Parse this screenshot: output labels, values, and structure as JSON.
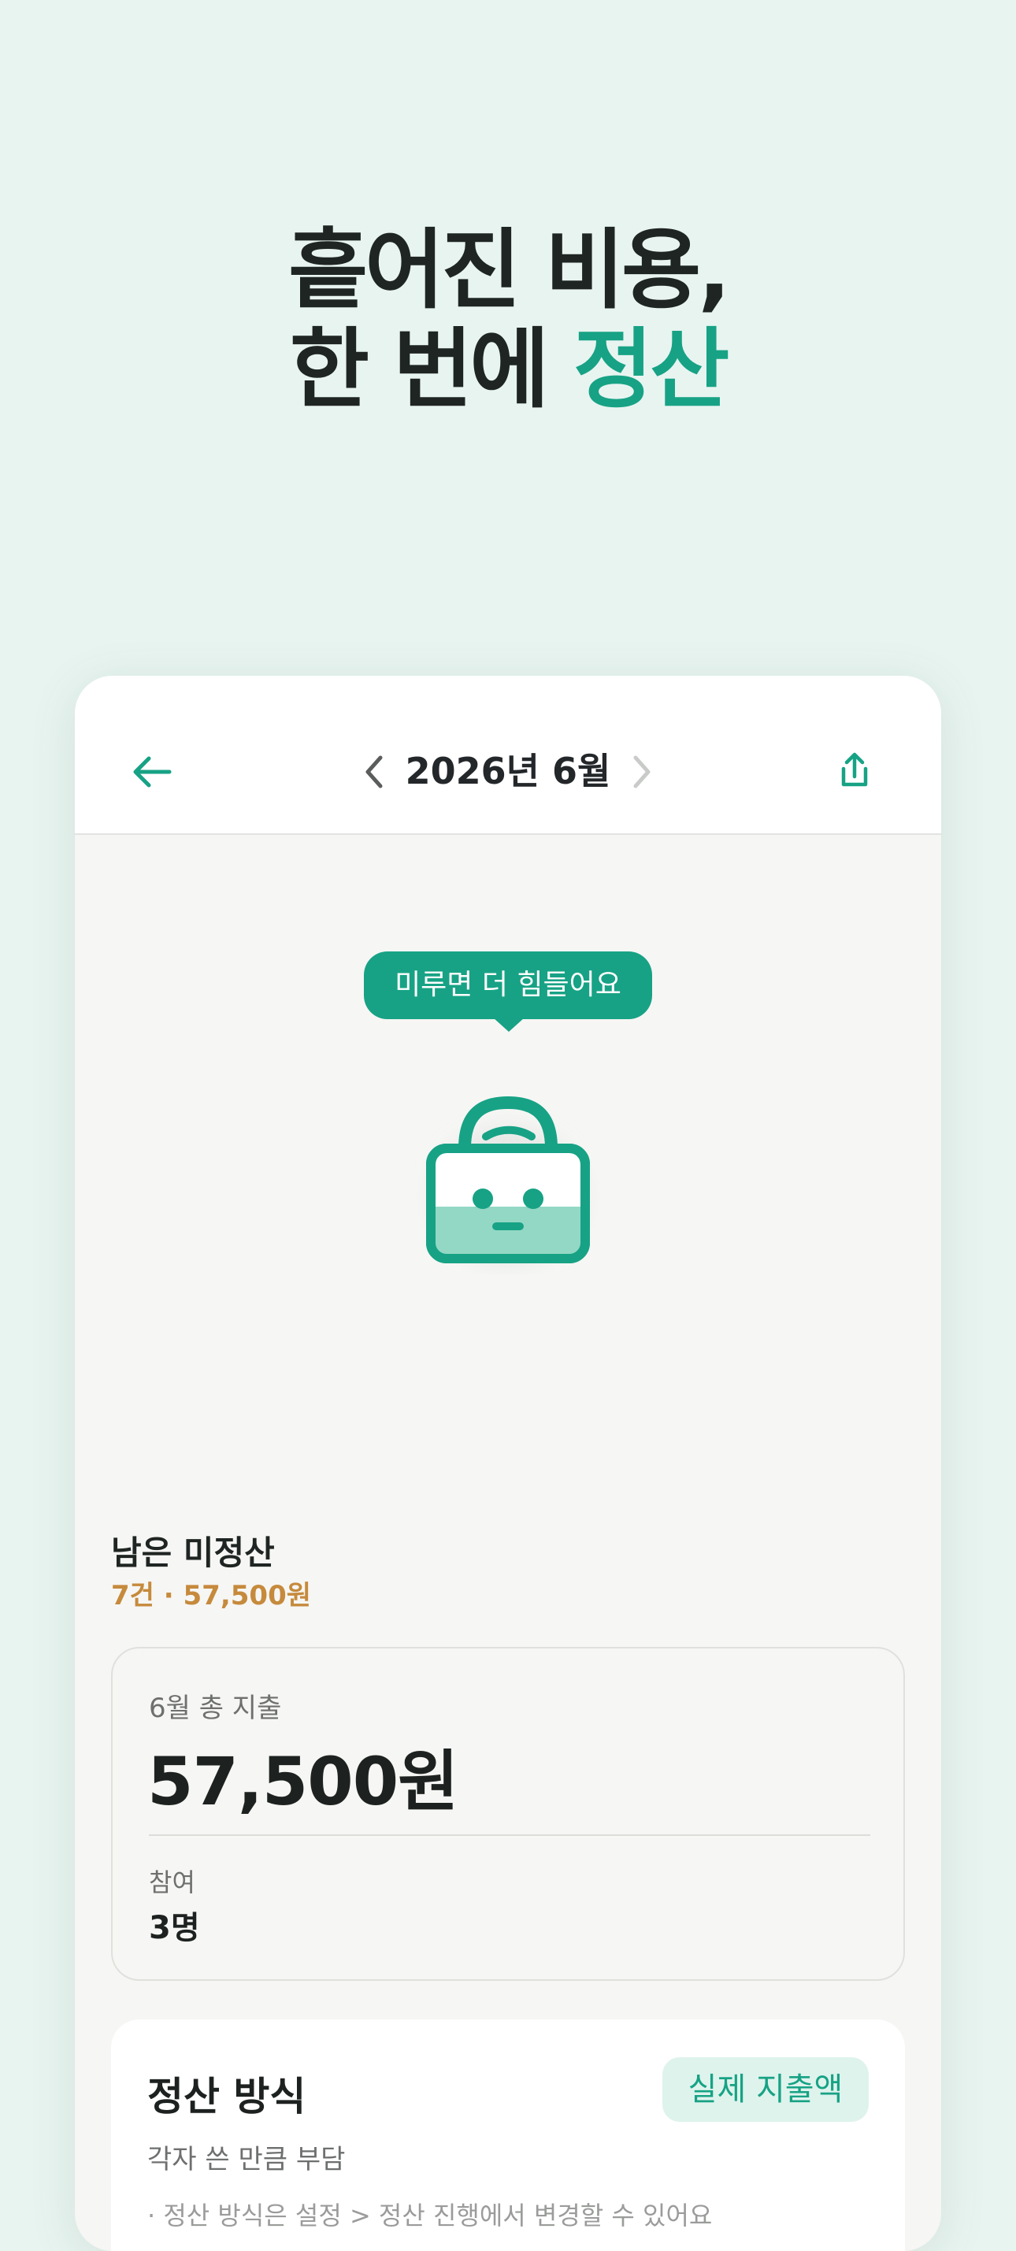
{
  "headline": {
    "line1": "흩어진 비용,",
    "line2_prefix": "한 번에 ",
    "line2_accent": "정산"
  },
  "header": {
    "back_icon": "arrow-left-icon",
    "month_label": "2026년 6월",
    "prev_icon": "chevron-left-icon",
    "next_icon": "chevron-right-icon",
    "share_icon": "share-icon"
  },
  "mascot": {
    "speech": "미루면 더 힘들어요",
    "icon": "lock-mascot-icon"
  },
  "remaining": {
    "title": "남은 미정산",
    "subtitle": "7건 · 57,500원"
  },
  "summary": {
    "total_label": "6월 총 지출",
    "total_amount": "57,500원",
    "people_label": "참여",
    "people_value": "3명"
  },
  "method": {
    "title": "정산 방식",
    "badge": "실제 지출액",
    "description": "각자 쓴 만큼 부담",
    "note": "· 정산 방식은 설정 > 정산 진행에서 변경할 수 있어요"
  },
  "colors": {
    "accent": "#17a285",
    "warning": "#c68a3c",
    "background": "#e8f4f0"
  }
}
